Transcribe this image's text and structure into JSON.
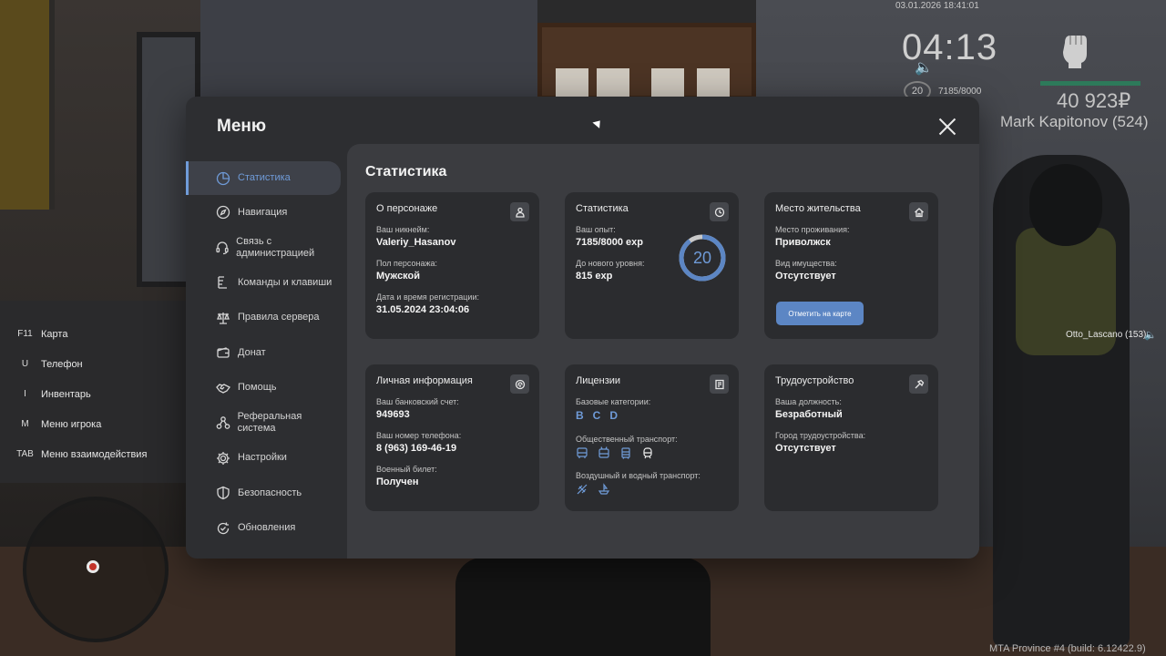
{
  "hud": {
    "datetime": "03.01.2026 18:41:01",
    "clock": "04:13",
    "level": "20",
    "exp": "7185/8000",
    "money": "40 923₽",
    "player_name": "Mark Kapitonov (524)",
    "nearby_player": "Otto_Lascano (153)",
    "build": "MTA Province #4 (build: 6.12422.9)",
    "hotkeys": [
      {
        "key": "F11",
        "label": "Карта"
      },
      {
        "key": "U",
        "label": "Телефон"
      },
      {
        "key": "I",
        "label": "Инвентарь"
      },
      {
        "key": "M",
        "label": "Меню игрока"
      },
      {
        "key": "TAB",
        "label": "Меню взаимодействия"
      }
    ]
  },
  "menu": {
    "title": "Меню",
    "sidebar": [
      {
        "label": "Статистика",
        "icon": "pie-chart-icon",
        "active": true
      },
      {
        "label": "Навигация",
        "icon": "compass-icon"
      },
      {
        "label": "Связь с администрацией",
        "icon": "headset-icon"
      },
      {
        "label": "Команды и клавиши",
        "icon": "keyboard-icon"
      },
      {
        "label": "Правила сервера",
        "icon": "scales-icon"
      },
      {
        "label": "Донат",
        "icon": "wallet-icon"
      },
      {
        "label": "Помощь",
        "icon": "handshake-icon"
      },
      {
        "label": "Реферальная система",
        "icon": "referral-icon"
      },
      {
        "label": "Настройки",
        "icon": "gear-icon"
      },
      {
        "label": "Безопасность",
        "icon": "shield-icon"
      },
      {
        "label": "Обновления",
        "icon": "refresh-icon"
      }
    ],
    "content_title": "Статистика",
    "cards": {
      "character": {
        "title": "О персонаже",
        "nick_label": "Ваш никнейм:",
        "nick": "Valeriy_Hasanov",
        "gender_label": "Пол персонажа:",
        "gender": "Мужской",
        "reg_label": "Дата и время регистрации:",
        "reg": "31.05.2024 23:04:06"
      },
      "stats": {
        "title": "Статистика",
        "exp_label": "Ваш опыт:",
        "exp": "7185/8000 exp",
        "next_label": "До нового уровня:",
        "next": "815 exp",
        "level": "20",
        "progress": 0.898
      },
      "residence": {
        "title": "Место жительства",
        "place_label": "Место проживания:",
        "place": "Приволжск",
        "property_label": "Вид имущества:",
        "property": "Отсутствует",
        "map_button": "Отметить на карте"
      },
      "personal": {
        "title": "Личная информация",
        "bank_label": "Ваш банковский счет:",
        "bank": "949693",
        "phone_label": "Ваш номер телефона:",
        "phone": "8 (963) 169-46-19",
        "military_label": "Военный билет:",
        "military": "Получен"
      },
      "licenses": {
        "title": "Лицензии",
        "base_label": "Базовые категории:",
        "base": [
          "B",
          "C",
          "D"
        ],
        "public_label": "Общественный транспорт:",
        "air_label": "Воздушный и водный транспорт:"
      },
      "employment": {
        "title": "Трудоустройство",
        "position_label": "Ваша должность:",
        "position": "Безработный",
        "city_label": "Город трудоустройства:",
        "city": "Отсутствует"
      }
    }
  },
  "colors": {
    "accent": "#6f9bd8",
    "button": "#5c86c4",
    "panel": "#2d2e31",
    "content": "#3b3c40",
    "card": "#2b2c2f"
  }
}
